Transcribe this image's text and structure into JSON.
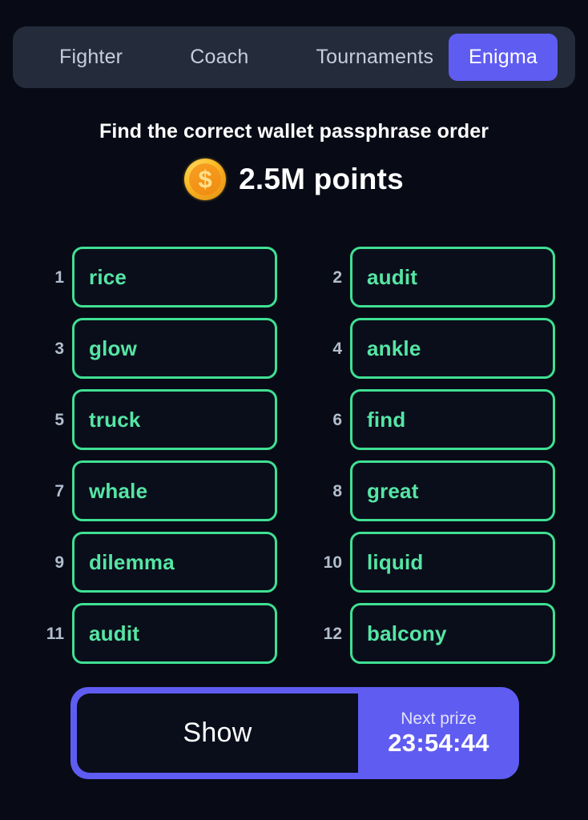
{
  "app": {
    "background_color": "#080b16",
    "accent_purple": "#5f5cf2",
    "accent_green": "#3fe093",
    "coin_color": "#f1a51c"
  },
  "tabs": [
    {
      "label": "Fighter",
      "active": false
    },
    {
      "label": "Coach",
      "active": false
    },
    {
      "label": "Tournaments",
      "active": false
    },
    {
      "label": "Enigma",
      "active": true
    }
  ],
  "header": {
    "title": "Find the correct wallet passphrase order"
  },
  "prize": {
    "coin_icon": "coin-dollar-icon",
    "coin_glyph": "$",
    "amount": "2.5M points"
  },
  "grid": {
    "cells": [
      {
        "number": "1",
        "word": "rice"
      },
      {
        "number": "2",
        "word": "audit"
      },
      {
        "number": "3",
        "word": "glow"
      },
      {
        "number": "4",
        "word": "ankle"
      },
      {
        "number": "5",
        "word": "truck"
      },
      {
        "number": "6",
        "word": "find"
      },
      {
        "number": "7",
        "word": "whale"
      },
      {
        "number": "8",
        "word": "great"
      },
      {
        "number": "9",
        "word": "dilemma"
      },
      {
        "number": "10",
        "word": "liquid"
      },
      {
        "number": "11",
        "word": "audit"
      },
      {
        "number": "12",
        "word": "balcony"
      }
    ]
  },
  "actions": {
    "show_label": "Show",
    "next_prize_label": "Next prize",
    "next_prize_timer": "23:54:44"
  }
}
